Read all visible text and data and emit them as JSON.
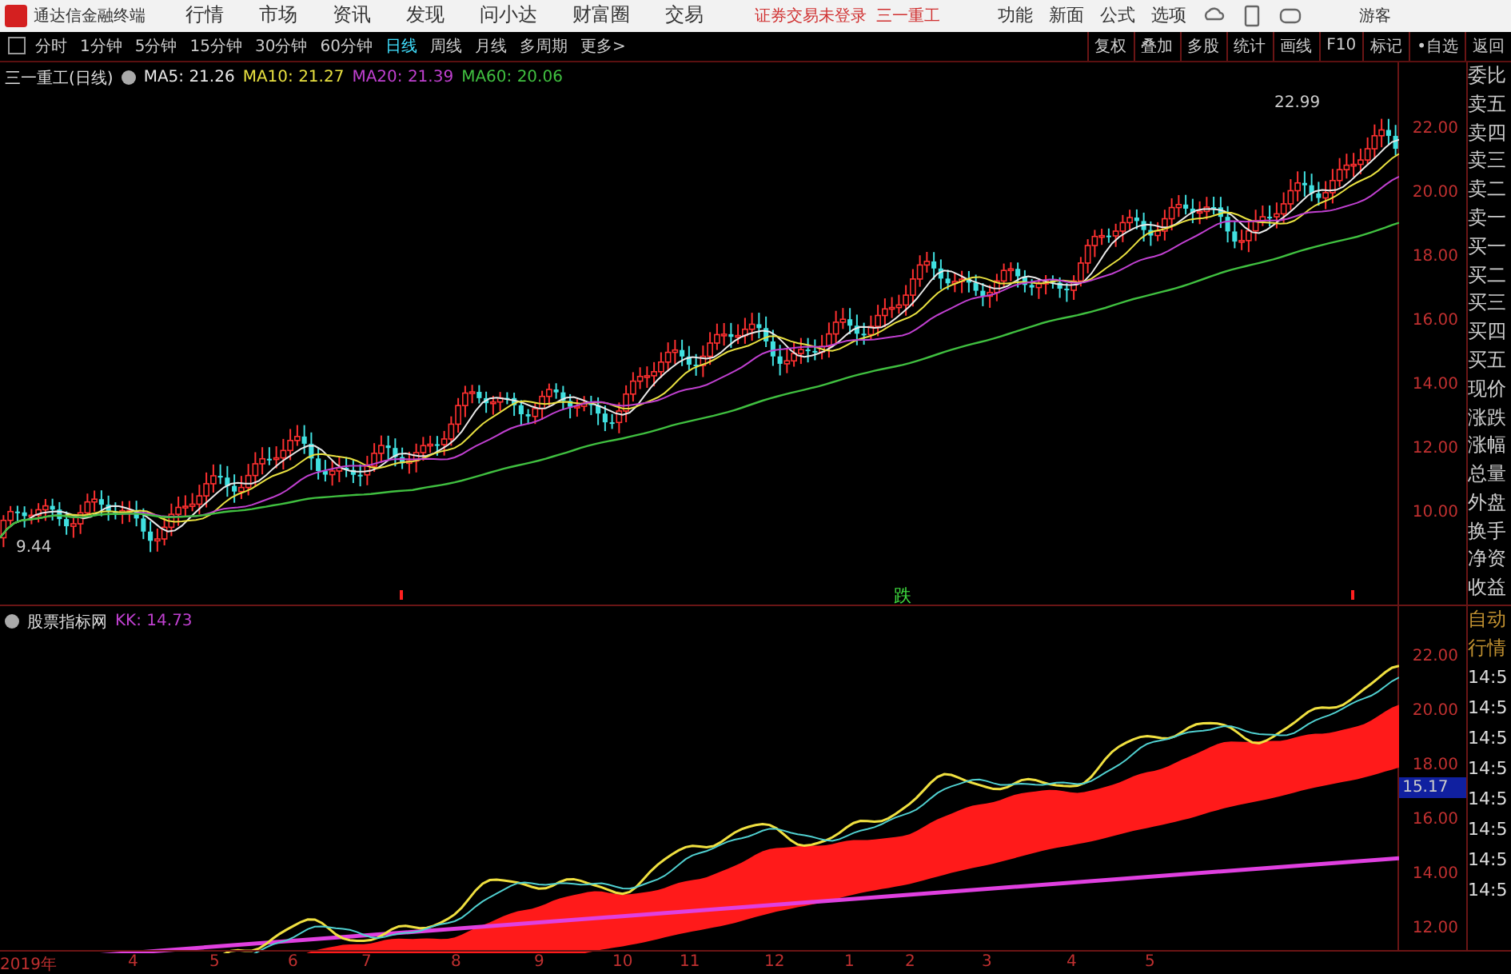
{
  "app": {
    "title": "通达信金融终端",
    "menu": [
      "行情",
      "市场",
      "资讯",
      "发现",
      "问小达",
      "财富圈",
      "交易"
    ],
    "login_status": "证券交易未登录",
    "stock": "三一重工",
    "tools": [
      "功能",
      "新面",
      "公式",
      "选项"
    ],
    "user": "游客"
  },
  "periods": [
    {
      "label": "分时",
      "selected": false
    },
    {
      "label": "1分钟",
      "selected": false
    },
    {
      "label": "5分钟",
      "selected": false
    },
    {
      "label": "15分钟",
      "selected": false
    },
    {
      "label": "30分钟",
      "selected": false
    },
    {
      "label": "60分钟",
      "selected": false
    },
    {
      "label": "日线",
      "selected": true
    },
    {
      "label": "周线",
      "selected": false
    },
    {
      "label": "月线",
      "selected": false
    },
    {
      "label": "多周期",
      "selected": false
    },
    {
      "label": "更多>",
      "selected": false
    }
  ],
  "chart_tools": [
    "复权",
    "叠加",
    "多股",
    "统计",
    "画线",
    "F10",
    "标记",
    "•自选",
    "返回"
  ],
  "main_chart": {
    "legend": "三一重工(日线)",
    "indicators": [
      {
        "name": "MA5: 21.26",
        "color": "#e8e8e8"
      },
      {
        "name": "MA10: 21.27",
        "color": "#e8e040"
      },
      {
        "name": "MA20: 21.39",
        "color": "#c040d0"
      },
      {
        "name": "MA60: 20.06",
        "color": "#40c040"
      }
    ],
    "high_label": "22.99",
    "low_label": "9.44",
    "signal_label": "跌",
    "y_labels": [
      "22.00",
      "20.00",
      "18.00",
      "16.00",
      "14.00",
      "12.00",
      "10.00"
    ]
  },
  "quote_panel": [
    "委比",
    "卖五",
    "卖四",
    "卖三",
    "卖二",
    "卖一",
    "买一",
    "买二",
    "买三",
    "买四",
    "买五",
    "现价",
    "涨跌",
    "涨幅",
    "总量",
    "外盘",
    "换手",
    "净资",
    "收益"
  ],
  "indicator_chart": {
    "legend": "股票指标网",
    "reading": "KK: 14.73",
    "y_labels": [
      "22.00",
      "20.00",
      "18.00",
      "16.00",
      "14.00",
      "12.00"
    ],
    "current": "15.17"
  },
  "trade_panel": {
    "header": [
      "自动",
      "行情"
    ],
    "times": [
      "14:5",
      "14:5",
      "14:5",
      "14:5",
      "14:5",
      "14:5",
      "14:5",
      "14:5"
    ]
  },
  "x_labels": [
    "2019年",
    "4",
    "5",
    "6",
    "7",
    "8",
    "9",
    "10",
    "11",
    "12",
    "1",
    "2",
    "3",
    "4",
    "5"
  ]
}
